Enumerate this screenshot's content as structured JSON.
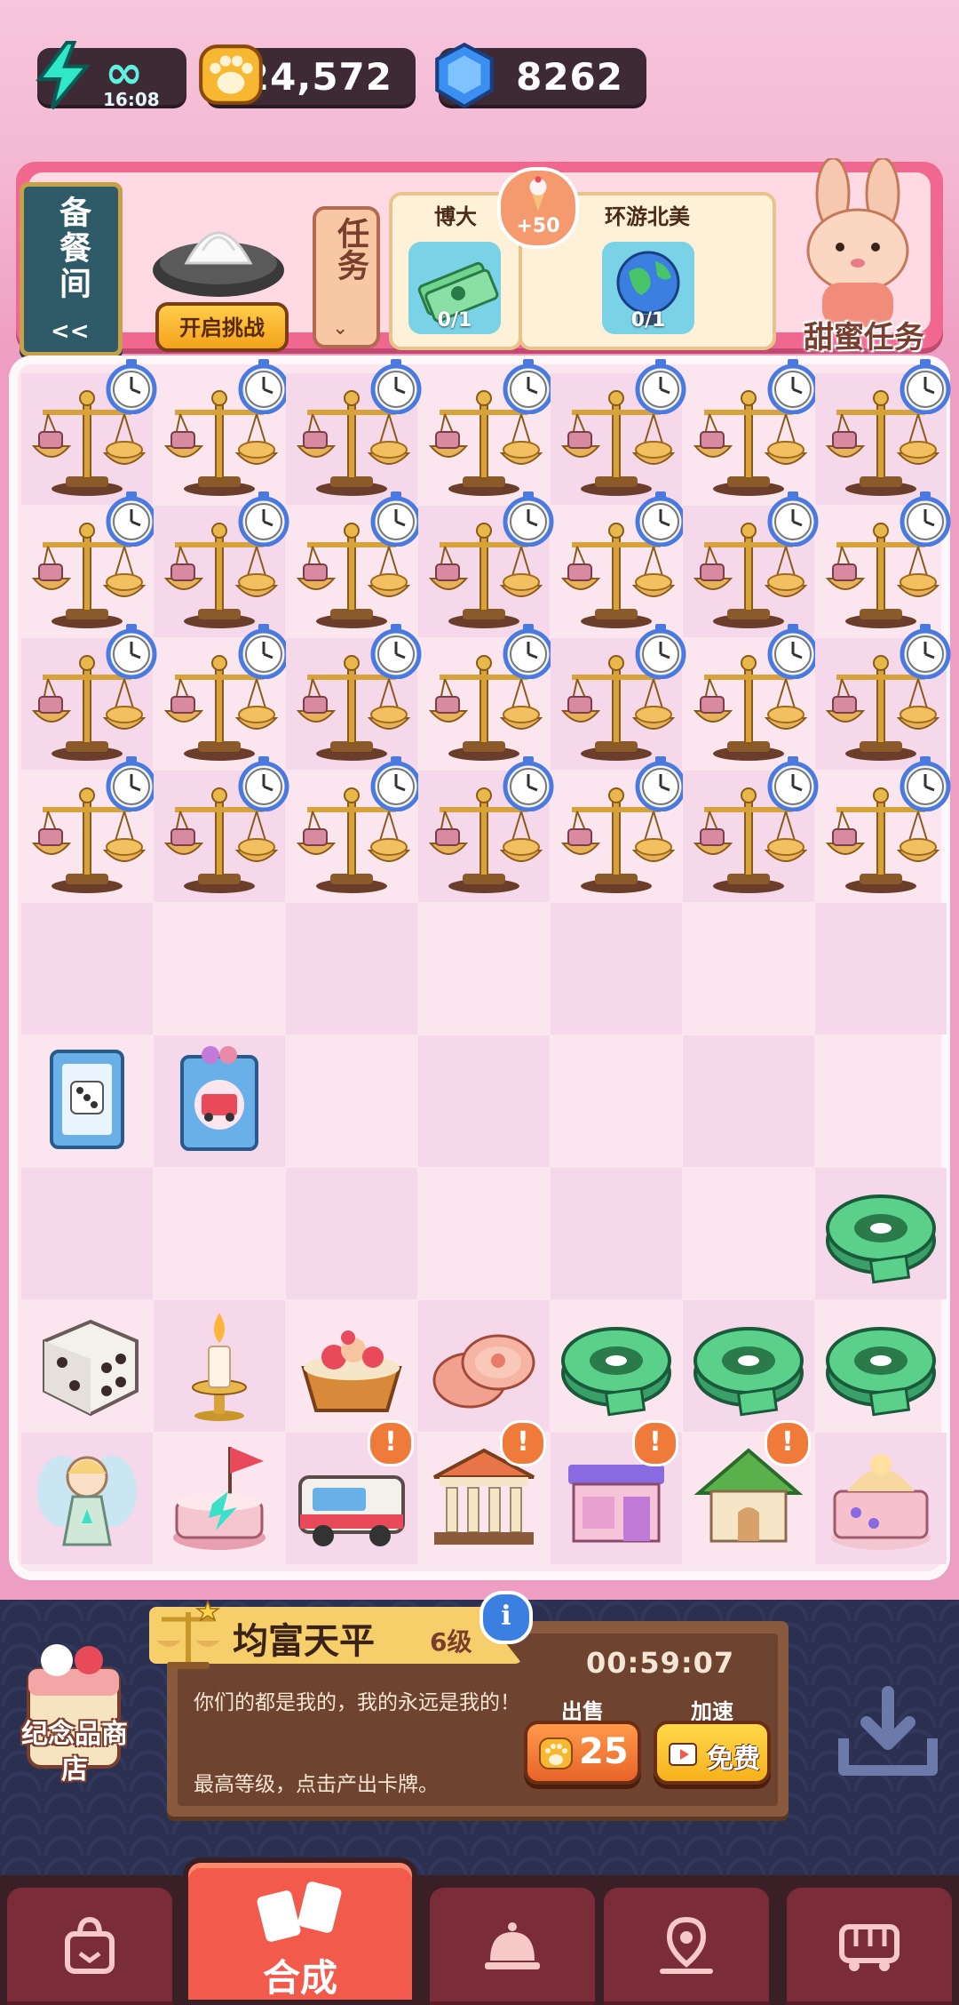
{
  "currency": {
    "energy_value": "∞",
    "energy_timer": "16:08",
    "paws": "24,572",
    "gems": "8262"
  },
  "top_bar": {
    "kitchen_label": "备餐间",
    "kitchen_arrow": "<<",
    "challenge_button": "开启挑战",
    "task_tab_label": "任务",
    "orders": [
      {
        "title": "博大",
        "progress": "0/1",
        "icon": "money-stack-icon"
      },
      {
        "title": "环游北美",
        "progress": "0/1",
        "icon": "globe-icon"
      }
    ],
    "reward_value": "+50",
    "sweet_task_label": "甜蜜任务"
  },
  "board": {
    "rows": 9,
    "cols": 7,
    "locked_scale_rows": 4
  },
  "info_panel": {
    "item_name": "均富天平",
    "item_level": "6级",
    "description": "你们的都是我的，我的永远是我的！",
    "hint": "最高等级，点击产出卡牌。",
    "timer": "00:59:07",
    "sell_label": "出售",
    "sell_price": "25",
    "speed_label": "加速",
    "speed_button": "免费",
    "info_icon": "i"
  },
  "souvenir": {
    "label": "纪念品商店"
  },
  "bottom_nav": {
    "merge_label": "合成",
    "items": [
      "shop-bag-icon",
      "merge-cards-icon",
      "service-bell-icon",
      "map-pin-icon",
      "bus-icon"
    ]
  },
  "colors": {
    "background_pink": "#f4b8d2",
    "board": "#fbe6f0",
    "panel_navy": "#2b3050",
    "nav_active": "#f25b4c"
  }
}
